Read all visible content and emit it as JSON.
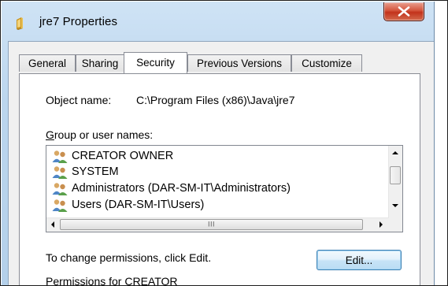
{
  "window": {
    "title": "jre7 Properties",
    "icon": "folder-icon",
    "close_glyph": "X"
  },
  "tabs": [
    {
      "label": "General",
      "active": false
    },
    {
      "label": "Sharing",
      "active": false
    },
    {
      "label": "Security",
      "active": true
    },
    {
      "label": "Previous Versions",
      "active": false
    },
    {
      "label": "Customize",
      "active": false
    }
  ],
  "security": {
    "object_name_label": "Object name:",
    "object_name_value": "C:\\Program Files (x86)\\Java\\jre7",
    "group_label": "Group or user names:",
    "users": [
      {
        "name": "CREATOR OWNER",
        "icon": "users-icon"
      },
      {
        "name": "SYSTEM",
        "icon": "users-icon"
      },
      {
        "name": "Administrators (DAR-SM-IT\\Administrators)",
        "icon": "users-icon"
      },
      {
        "name": "Users (DAR-SM-IT\\Users)",
        "icon": "users-icon"
      }
    ],
    "change_permissions_text": "To change permissions, click Edit.",
    "edit_button_label": "Edit...",
    "permissions_for_label": "Permissions for CREATOR"
  },
  "colors": {
    "glass": "#bcd6ee",
    "close_red": "#c2321b",
    "dialog_bg": "#f0f0f0",
    "edit_border": "#3c7fb1"
  }
}
